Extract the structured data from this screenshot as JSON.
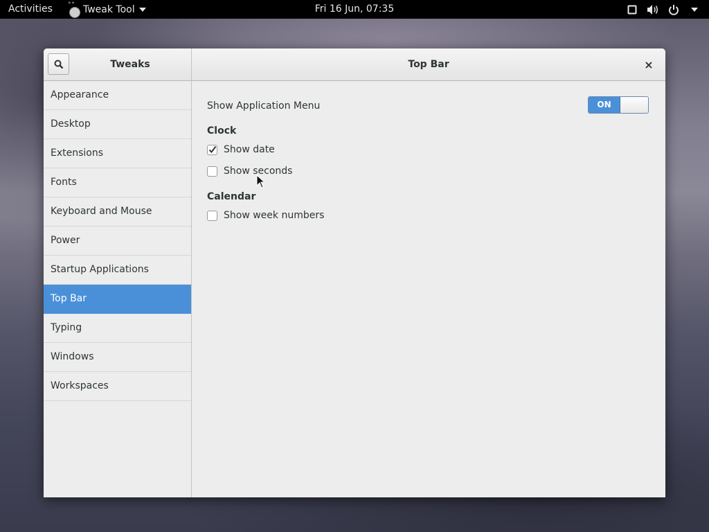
{
  "topbar": {
    "activities": "Activities",
    "app_name": "Tweak Tool",
    "clock": "Fri 16 Jun, 07:35"
  },
  "window": {
    "sidebar_title": "Tweaks",
    "page_title": "Top Bar",
    "close_glyph": "×"
  },
  "sidebar": {
    "items": [
      {
        "label": "Appearance"
      },
      {
        "label": "Desktop"
      },
      {
        "label": "Extensions"
      },
      {
        "label": "Fonts"
      },
      {
        "label": "Keyboard and Mouse"
      },
      {
        "label": "Power"
      },
      {
        "label": "Startup Applications"
      },
      {
        "label": "Top Bar"
      },
      {
        "label": "Typing"
      },
      {
        "label": "Windows"
      },
      {
        "label": "Workspaces"
      }
    ],
    "selected": "Top Bar"
  },
  "content": {
    "app_menu_label": "Show Application Menu",
    "app_menu_switch": "ON",
    "clock_header": "Clock",
    "show_date": {
      "label": "Show date",
      "checked": true
    },
    "show_seconds": {
      "label": "Show seconds",
      "checked": false
    },
    "calendar_header": "Calendar",
    "show_week_numbers": {
      "label": "Show week numbers",
      "checked": false
    }
  },
  "colors": {
    "accent": "#4a90d9",
    "topbar": "#000000",
    "window_bg": "#ededed"
  }
}
